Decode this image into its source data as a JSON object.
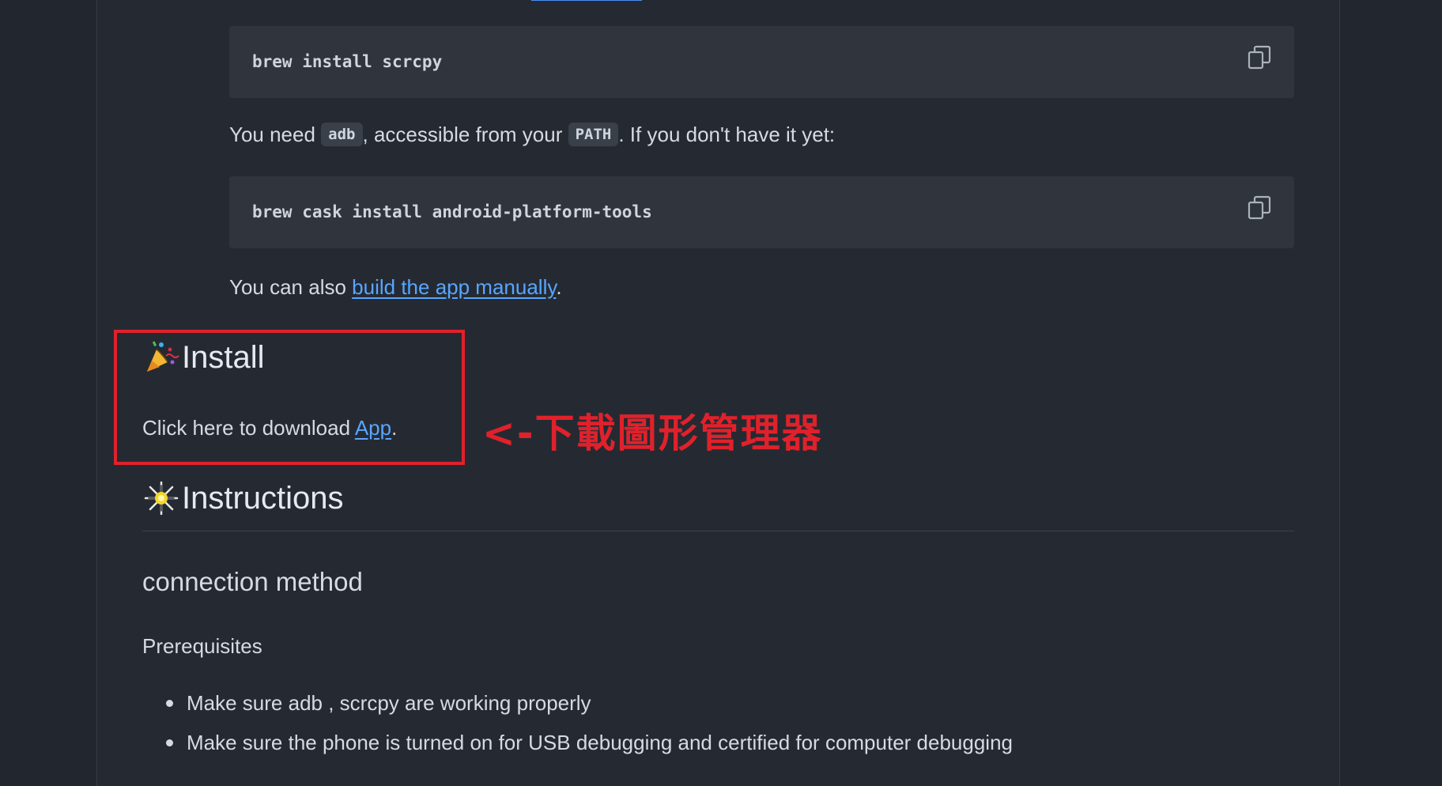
{
  "code_blocks": [
    {
      "command": "brew install scrcpy",
      "copy_icon": "copy-icon"
    },
    {
      "command": "brew cask install android-platform-tools",
      "copy_icon": "copy-icon"
    }
  ],
  "adb_paragraph": {
    "prefix": "You need ",
    "code_adb": "adb",
    "middle": ", accessible from your ",
    "code_path": "PATH",
    "suffix": ". If you don't have it yet:"
  },
  "build_paragraph": {
    "prefix": "You can also ",
    "link": "build the app manually",
    "suffix": "."
  },
  "install_section": {
    "heading": "Install",
    "emoji_icon": "party-popper-icon",
    "text_prefix": "Click here to download ",
    "link": "App",
    "text_suffix": "."
  },
  "annotation": {
    "text": "<-下載圖形管理器",
    "color": "#e0212b"
  },
  "instructions_section": {
    "heading": "Instructions",
    "emoji_icon": "sparkler-icon",
    "subheading": "connection method",
    "prereq_heading": "Prerequisites",
    "bullets": [
      "Make sure adb , scrcpy are working properly",
      "Make sure the phone is turned on for USB debugging and certified for computer debugging"
    ]
  },
  "colors": {
    "background": "#22262e",
    "link": "#58a6ff",
    "code_background": "#2f343d"
  }
}
